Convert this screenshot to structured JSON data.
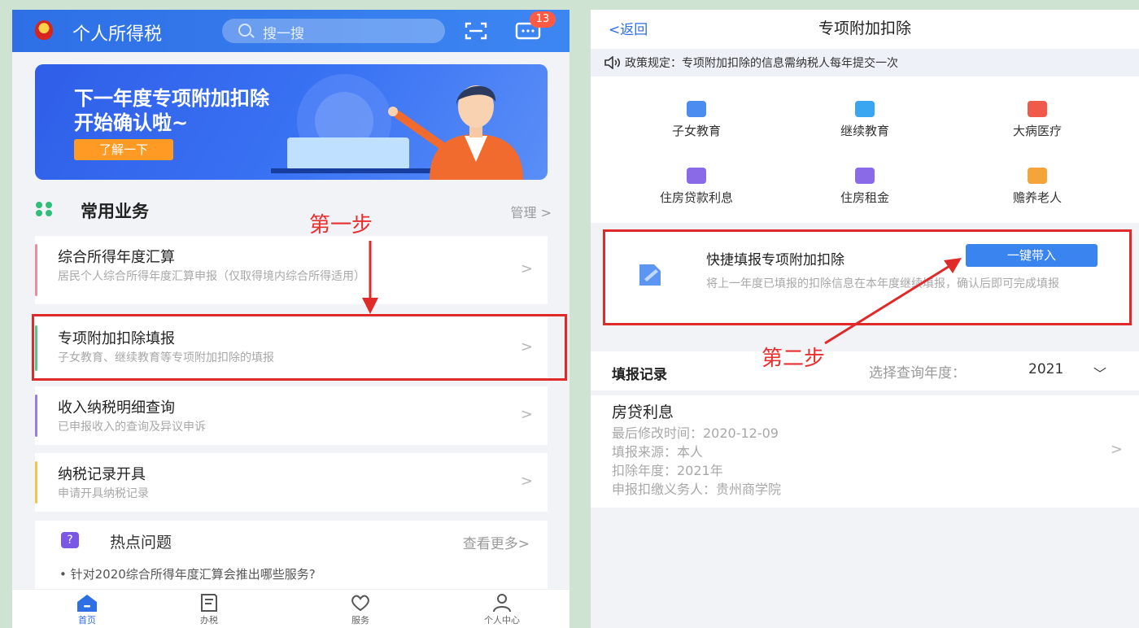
{
  "left": {
    "app_title": "个人所得税",
    "search_placeholder": "搜一搜",
    "message_badge": "13",
    "banner": {
      "line1": "下一年度专项附加扣除",
      "line2": "开始确认啦~",
      "button": "了解一下"
    },
    "common": {
      "title": "常用业务",
      "manage": "管理 >"
    },
    "services": [
      {
        "title": "综合所得年度汇算",
        "subtitle": "居民个人综合所得年度汇算申报（仅取得境内综合所得适用）",
        "bar_color": "#f08b9a"
      },
      {
        "title": "专项附加扣除填报",
        "subtitle": "子女教育、继续教育等专项附加扣除的填报",
        "bar_color": "#4fc98c"
      },
      {
        "title": "收入纳税明细查询",
        "subtitle": "已申报收入的查询及异议申诉",
        "bar_color": "#9b7be6"
      },
      {
        "title": "纳税记录开具",
        "subtitle": "申请开具纳税记录",
        "bar_color": "#f3c452"
      }
    ],
    "step_label": "第一步",
    "hot": {
      "title": "热点问题",
      "more": "查看更多>",
      "question": "• 针对2020综合所得年度汇算会推出哪些服务?"
    },
    "tabs": [
      {
        "label": "首页",
        "icon": "home-icon",
        "active": true
      },
      {
        "label": "办税",
        "icon": "document-icon",
        "active": false
      },
      {
        "label": "服务",
        "icon": "heart-hand-icon",
        "active": false
      },
      {
        "label": "个人中心",
        "icon": "person-icon",
        "active": false
      }
    ]
  },
  "right": {
    "back": "<返回",
    "title": "专项附加扣除",
    "notice": "政策规定：专项附加扣除的信息需纳税人每年提交一次",
    "categories": [
      {
        "label": "子女教育",
        "icon": "children-education-icon",
        "color": "#4a8cf0"
      },
      {
        "label": "继续教育",
        "icon": "graduation-cap-icon",
        "color": "#3aa5f0"
      },
      {
        "label": "大病医疗",
        "icon": "medical-kit-icon",
        "color": "#ef5a4a"
      },
      {
        "label": "住房贷款利息",
        "icon": "house-loan-icon",
        "color": "#8b6ae8"
      },
      {
        "label": "住房租金",
        "icon": "house-rent-icon",
        "color": "#8b6ae8"
      },
      {
        "label": "赡养老人",
        "icon": "elderly-care-icon",
        "color": "#f5a43a"
      }
    ],
    "quick": {
      "title": "快捷填报专项附加扣除",
      "button": "一键带入",
      "desc": "将上一年度已填报的扣除信息在本年度继续填报，确认后即可完成填报"
    },
    "step_label": "第二步",
    "records": {
      "title": "填报记录",
      "select_label": "选择查询年度：",
      "select_value": "2021",
      "item": {
        "name": "房贷利息",
        "modified": "最后修改时间：2020-12-09",
        "source": "填报来源：本人",
        "year": "扣除年度：2021年",
        "obligor": "申报扣缴义务人：贵州商学院"
      }
    }
  }
}
